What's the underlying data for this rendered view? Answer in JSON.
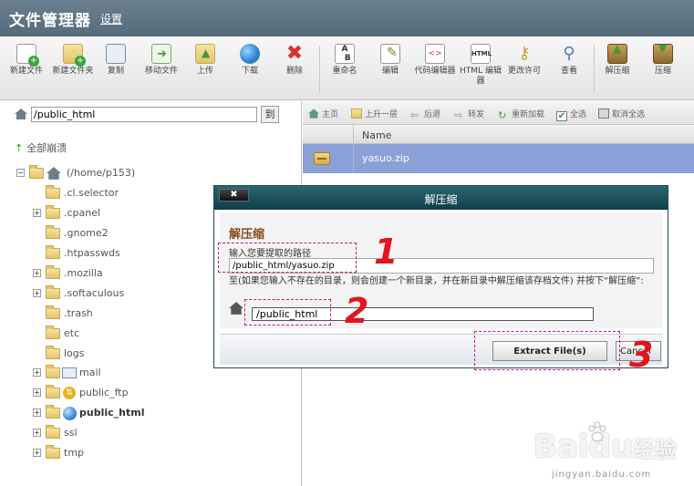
{
  "header": {
    "title": "文件管理器",
    "settings_label": "设置"
  },
  "toolbar": {
    "new_file": "新建文件",
    "new_folder": "新建文件夹",
    "copy": "复制",
    "move": "移动文件",
    "upload": "上传",
    "download": "下载",
    "delete": "删除",
    "rename": "重命名",
    "edit": "编辑",
    "code_editor": "代码编辑器",
    "html_editor": "HTML 编辑器",
    "permissions": "更改许可",
    "view": "查看",
    "extract": "解压缩",
    "compress": "压缩"
  },
  "left": {
    "path_value": "/public_html",
    "go_label": "到",
    "collapse_all": "全部崩溃",
    "tree": {
      "root": "(/home/p153)",
      "cl_selector": ".cl.selector",
      "cpanel": ".cpanel",
      "gnome2": ".gnome2",
      "htpasswds": ".htpasswds",
      "mozilla": ".mozilla",
      "softaculous": ".softaculous",
      "trash": ".trash",
      "etc": "etc",
      "logs": "logs",
      "mail": "mail",
      "public_ftp": "public_ftp",
      "public_html": "public_html",
      "ssl": "ssl",
      "tmp": "tmp"
    }
  },
  "right": {
    "home": "主页",
    "up_one": "上升一层",
    "back": "后退",
    "forward": "转发",
    "reload": "重新加载",
    "select_all": "全选",
    "unselect_all": "取消全选",
    "col_name": "Name",
    "file": "yasuo.zip"
  },
  "dialog": {
    "close_label": "✖",
    "title": "解压缩",
    "heading": "解压缩",
    "prompt": "输入您要提取的路径",
    "source_path": "/public_html/yasuo.zip",
    "note": "至(如果您输入不存在的目录，则会创建一个新目录，并在新目录中解压缩该存档文件) 并按下“解压缩”:",
    "dest_path": "/public_html",
    "extract_button": "Extract File(s)",
    "cancel_button": "Cancel"
  },
  "annotations": {
    "n1": "1",
    "n2": "2",
    "n3": "3"
  },
  "watermark": {
    "brand": "Baidu",
    "suffix": "经验",
    "url": "jingyan.baidu.com"
  },
  "colors": {
    "header": "#5f7483",
    "selected_row": "#8aa0d6",
    "dialog_title": "#113f49",
    "annotation": "#e0151e"
  },
  "icons": [
    "new-file-icon",
    "new-folder-icon",
    "copy-icon",
    "move-icon",
    "upload-icon",
    "download-icon",
    "delete-icon",
    "rename-icon",
    "edit-icon",
    "code-editor-icon",
    "html-editor-icon",
    "permissions-icon",
    "view-icon",
    "extract-icon",
    "compress-icon",
    "home-icon",
    "folder-icon",
    "zip-icon"
  ]
}
